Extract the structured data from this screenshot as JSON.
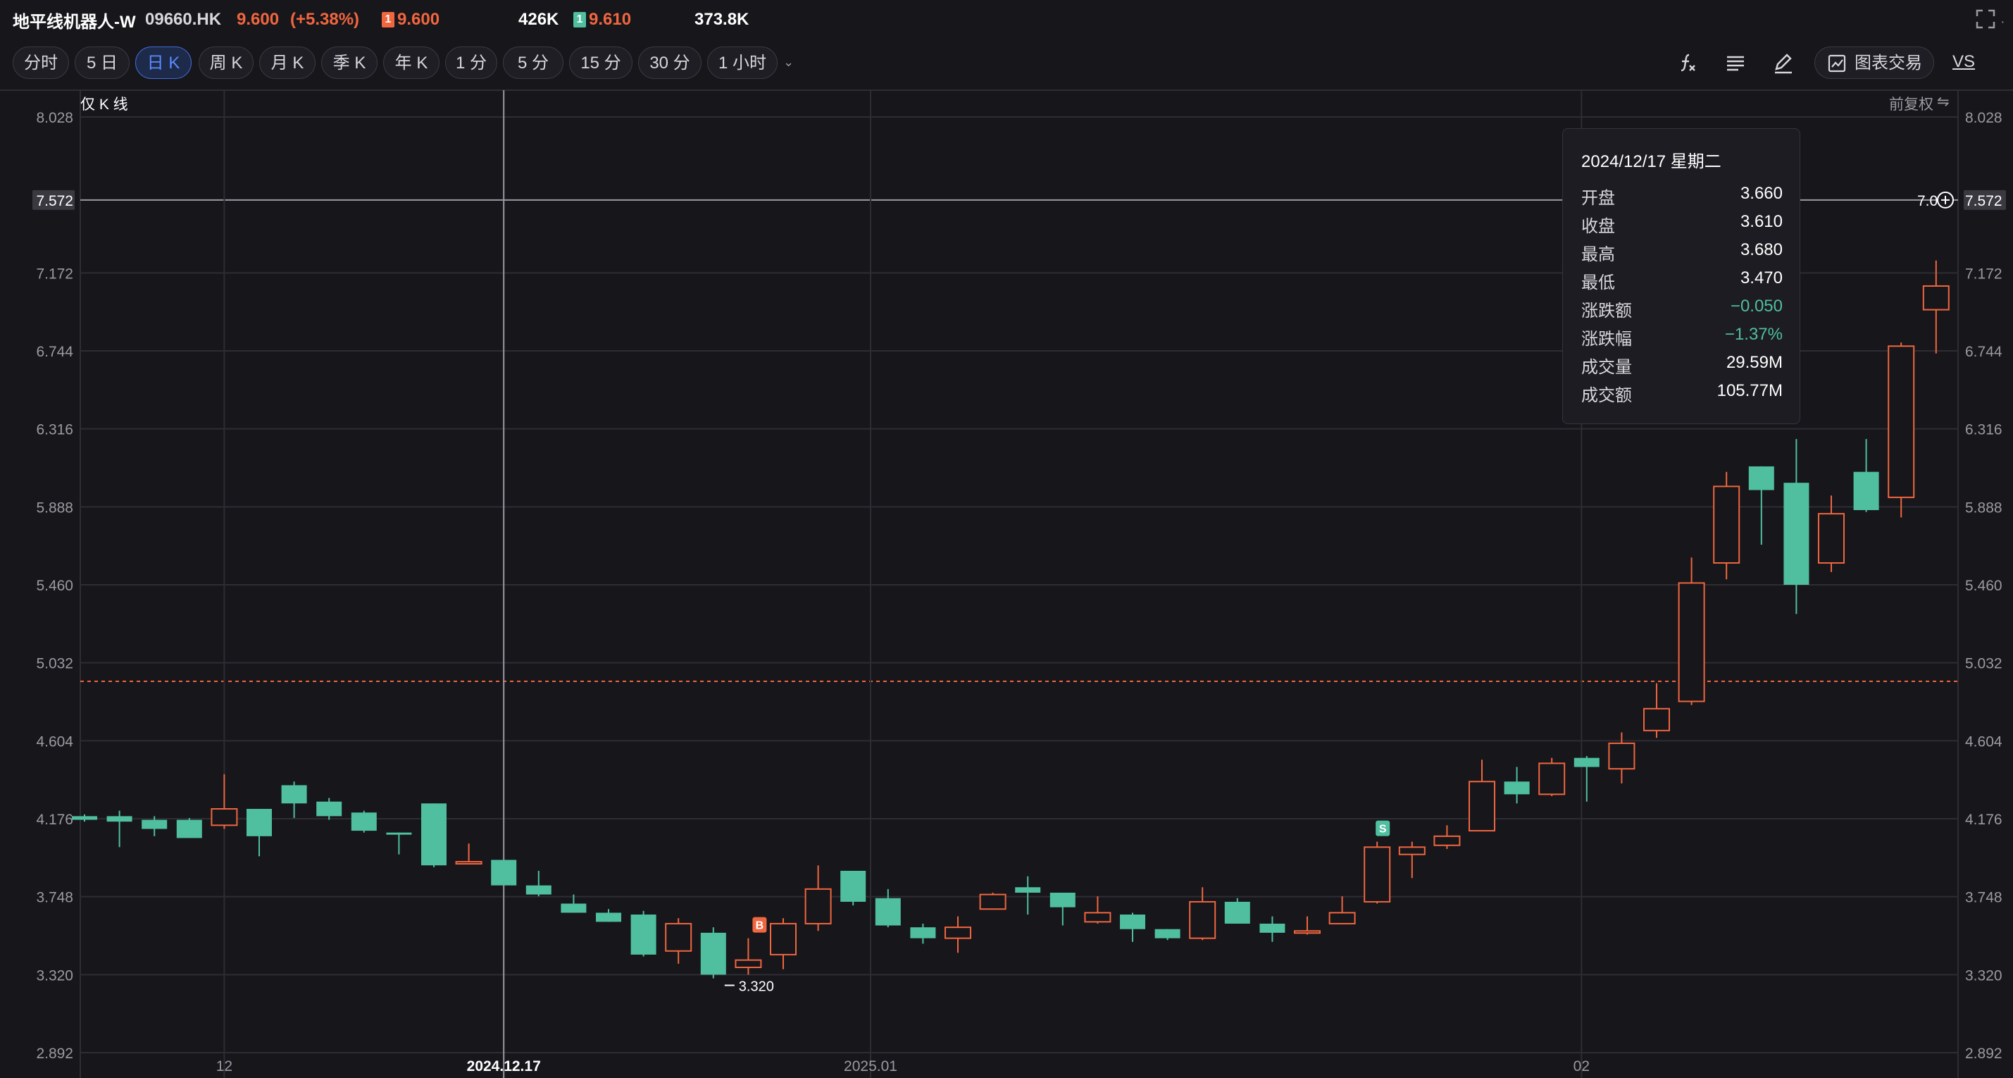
{
  "header": {
    "stock_name": "地平线机器人-W",
    "stock_code": "09660.HK",
    "price": "9.600",
    "price_change": "(+5.38%)",
    "ask_badge": "1",
    "ask_price": "9.600",
    "ask_volume": "426K",
    "bid_badge": "1",
    "bid_price": "9.610",
    "bid_volume": "373.8K"
  },
  "toolbar": {
    "periods": [
      "分时",
      "5 日",
      "日 K",
      "周 K",
      "月 K",
      "季 K",
      "年 K",
      "1 分",
      "5 分",
      "15 分",
      "30 分",
      "1 小时"
    ],
    "active_period": "日 K",
    "chart_trade_label": "图表交易",
    "vs_label": "VS",
    "icons": [
      "formula-icon",
      "list-icon",
      "pencil-icon",
      "chart-trade-icon"
    ]
  },
  "chart": {
    "only_k_label": "仅 K 线",
    "adjust_label": "前复权",
    "adjust_icon": "swap-icon",
    "crosshair_price": "7.572",
    "crosshair_date": "2024.12.17",
    "cursor_value_partial": "7.0",
    "low_marker": "3.320",
    "buy_marker": "B",
    "sell_marker": "S"
  },
  "tooltip": {
    "date": "2024/12/17 星期二",
    "rows": [
      {
        "label": "开盘",
        "value": "3.660",
        "tone": "normal"
      },
      {
        "label": "收盘",
        "value": "3.610",
        "tone": "normal"
      },
      {
        "label": "最高",
        "value": "3.680",
        "tone": "normal"
      },
      {
        "label": "最低",
        "value": "3.470",
        "tone": "normal"
      },
      {
        "label": "涨跌额",
        "value": "−0.050",
        "tone": "down"
      },
      {
        "label": "涨跌幅",
        "value": "−1.37%",
        "tone": "down"
      },
      {
        "label": "成交量",
        "value": "29.59M",
        "tone": "normal"
      },
      {
        "label": "成交额",
        "value": "105.77M",
        "tone": "normal"
      }
    ]
  },
  "chart_data": {
    "type": "candlestick",
    "y_ticks": [
      "8.028",
      "7.572",
      "7.172",
      "6.744",
      "6.316",
      "5.888",
      "5.460",
      "5.032",
      "4.604",
      "4.176",
      "3.748",
      "3.320",
      "2.892"
    ],
    "ylim": [
      2.892,
      8.028
    ],
    "x_labels": [
      "12",
      "2024.12.17",
      "2025.01",
      "02"
    ],
    "reference_line": 4.93,
    "colors": {
      "up": "#f0663f",
      "down": "#4fbf9f",
      "grid": "#2e2d33",
      "background": "#17161b"
    },
    "candles": [
      {
        "date": "2024-11-29",
        "o": 4.19,
        "c": 4.17,
        "h": 4.2,
        "l": 4.16
      },
      {
        "date": "2024-12-02",
        "o": 4.19,
        "c": 4.16,
        "h": 4.22,
        "l": 4.02
      },
      {
        "date": "2024-12-03",
        "o": 4.17,
        "c": 4.12,
        "h": 4.19,
        "l": 4.08
      },
      {
        "date": "2024-12-04",
        "o": 4.17,
        "c": 4.07,
        "h": 4.18,
        "l": 4.07
      },
      {
        "date": "2024-12-05",
        "o": 4.14,
        "c": 4.23,
        "h": 4.42,
        "l": 4.12
      },
      {
        "date": "2024-12-06",
        "o": 4.23,
        "c": 4.08,
        "h": 4.23,
        "l": 3.97
      },
      {
        "date": "2024-12-09",
        "o": 4.36,
        "c": 4.26,
        "h": 4.38,
        "l": 4.18
      },
      {
        "date": "2024-12-10",
        "o": 4.27,
        "c": 4.19,
        "h": 4.29,
        "l": 4.17
      },
      {
        "date": "2024-12-11",
        "o": 4.21,
        "c": 4.11,
        "h": 4.22,
        "l": 4.1
      },
      {
        "date": "2024-12-12",
        "o": 4.1,
        "c": 4.09,
        "h": 4.1,
        "l": 3.98
      },
      {
        "date": "2024-12-13",
        "o": 4.26,
        "c": 3.92,
        "h": 4.26,
        "l": 3.91
      },
      {
        "date": "2024-12-16",
        "o": 3.93,
        "c": 3.94,
        "h": 4.04,
        "l": 3.93
      },
      {
        "date": "2024-12-17",
        "o": 3.95,
        "c": 3.81,
        "h": 3.95,
        "l": 3.81
      },
      {
        "date": "2024-12-18",
        "o": 3.81,
        "c": 3.76,
        "h": 3.89,
        "l": 3.75
      },
      {
        "date": "2024-12-19",
        "o": 3.71,
        "c": 3.66,
        "h": 3.76,
        "l": 3.66
      },
      {
        "date": "2024-12-20",
        "o": 3.66,
        "c": 3.61,
        "h": 3.68,
        "l": 3.61
      },
      {
        "date": "2024-12-23",
        "o": 3.65,
        "c": 3.43,
        "h": 3.67,
        "l": 3.42
      },
      {
        "date": "2024-12-24",
        "o": 3.45,
        "c": 3.6,
        "h": 3.63,
        "l": 3.38
      },
      {
        "date": "2024-12-27",
        "o": 3.55,
        "c": 3.32,
        "h": 3.58,
        "l": 3.3
      },
      {
        "date": "2024-12-30",
        "o": 3.36,
        "c": 3.4,
        "h": 3.52,
        "l": 3.32
      },
      {
        "date": "2024-12-31",
        "o": 3.43,
        "c": 3.6,
        "h": 3.63,
        "l": 3.35
      },
      {
        "date": "2025-01-02",
        "o": 3.6,
        "c": 3.79,
        "h": 3.92,
        "l": 3.56
      },
      {
        "date": "2025-01-03",
        "o": 3.89,
        "c": 3.72,
        "h": 3.89,
        "l": 3.7
      },
      {
        "date": "2025-01-06",
        "o": 3.74,
        "c": 3.59,
        "h": 3.79,
        "l": 3.58
      },
      {
        "date": "2025-01-07",
        "o": 3.58,
        "c": 3.52,
        "h": 3.6,
        "l": 3.49
      },
      {
        "date": "2025-01-08",
        "o": 3.52,
        "c": 3.58,
        "h": 3.64,
        "l": 3.44
      },
      {
        "date": "2025-01-09",
        "o": 3.68,
        "c": 3.76,
        "h": 3.77,
        "l": 3.68
      },
      {
        "date": "2025-01-10",
        "o": 3.8,
        "c": 3.77,
        "h": 3.86,
        "l": 3.65
      },
      {
        "date": "2025-01-13",
        "o": 3.77,
        "c": 3.69,
        "h": 3.77,
        "l": 3.59
      },
      {
        "date": "2025-01-14",
        "o": 3.61,
        "c": 3.66,
        "h": 3.75,
        "l": 3.6
      },
      {
        "date": "2025-01-15",
        "o": 3.65,
        "c": 3.57,
        "h": 3.66,
        "l": 3.5
      },
      {
        "date": "2025-01-16",
        "o": 3.57,
        "c": 3.52,
        "h": 3.57,
        "l": 3.51
      },
      {
        "date": "2025-01-17",
        "o": 3.52,
        "c": 3.72,
        "h": 3.8,
        "l": 3.51
      },
      {
        "date": "2025-01-20",
        "o": 3.72,
        "c": 3.6,
        "h": 3.74,
        "l": 3.6
      },
      {
        "date": "2025-01-21",
        "o": 3.6,
        "c": 3.55,
        "h": 3.64,
        "l": 3.5
      },
      {
        "date": "2025-01-22",
        "o": 3.55,
        "c": 3.56,
        "h": 3.64,
        "l": 3.54
      },
      {
        "date": "2025-01-23",
        "o": 3.6,
        "c": 3.66,
        "h": 3.75,
        "l": 3.6
      },
      {
        "date": "2025-01-24",
        "o": 3.72,
        "c": 4.02,
        "h": 4.05,
        "l": 3.71
      },
      {
        "date": "2025-01-27",
        "o": 3.98,
        "c": 4.02,
        "h": 4.05,
        "l": 3.85
      },
      {
        "date": "2025-01-28",
        "o": 4.03,
        "c": 4.08,
        "h": 4.14,
        "l": 4.01
      },
      {
        "date": "2025-02-03",
        "o": 4.11,
        "c": 4.38,
        "h": 4.5,
        "l": 4.11
      },
      {
        "date": "2025-02-04",
        "o": 4.38,
        "c": 4.31,
        "h": 4.46,
        "l": 4.26
      },
      {
        "date": "2025-02-05",
        "o": 4.31,
        "c": 4.48,
        "h": 4.51,
        "l": 4.3
      },
      {
        "date": "2025-02-06",
        "o": 4.51,
        "c": 4.46,
        "h": 4.52,
        "l": 4.27
      },
      {
        "date": "2025-02-07",
        "o": 4.45,
        "c": 4.59,
        "h": 4.65,
        "l": 4.37
      },
      {
        "date": "2025-02-10",
        "o": 4.66,
        "c": 4.78,
        "h": 4.92,
        "l": 4.62
      },
      {
        "date": "2025-02-11",
        "o": 4.82,
        "c": 5.47,
        "h": 5.61,
        "l": 4.8
      },
      {
        "date": "2025-02-12",
        "o": 5.58,
        "c": 6.0,
        "h": 6.08,
        "l": 5.49
      },
      {
        "date": "2025-02-13",
        "o": 6.11,
        "c": 5.98,
        "h": 6.11,
        "l": 5.68
      },
      {
        "date": "2025-02-14",
        "o": 6.02,
        "c": 5.46,
        "h": 6.26,
        "l": 5.3
      },
      {
        "date": "2025-02-17",
        "o": 5.58,
        "c": 5.85,
        "h": 5.95,
        "l": 5.53
      },
      {
        "date": "2025-02-18",
        "o": 6.08,
        "c": 5.87,
        "h": 6.26,
        "l": 5.86
      },
      {
        "date": "2025-02-19",
        "o": 5.94,
        "c": 6.77,
        "h": 6.79,
        "l": 5.83
      },
      {
        "date": "2025-02-20",
        "o": 6.97,
        "c": 7.1,
        "h": 7.24,
        "l": 6.73
      }
    ]
  }
}
